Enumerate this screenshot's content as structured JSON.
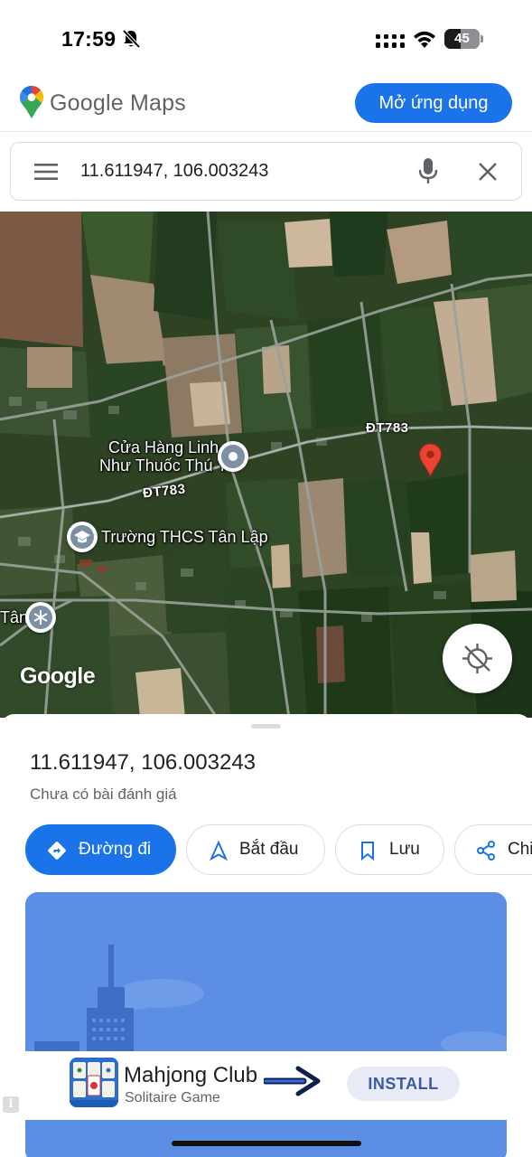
{
  "status_bar": {
    "time": "17:59",
    "battery_percent": "45",
    "battery_level": 0.45
  },
  "header": {
    "brand": "Google Maps",
    "open_app_label": "Mở ứng dụng",
    "accent_color": "#1a73e8"
  },
  "search": {
    "query": "11.611947, 106.003243",
    "icons": [
      "menu-icon",
      "mic-icon",
      "close-icon"
    ]
  },
  "map": {
    "road_labels": [
      "ĐT783",
      "ĐT783"
    ],
    "pois": [
      {
        "name_line1": "Cửa Hàng Linh",
        "name_line2": "Như Thuốc Thú Y",
        "icon": "pin-icon"
      },
      {
        "name": "Trường THCS Tân Lập",
        "icon": "school-icon"
      },
      {
        "name": "Tân",
        "icon": "snowflake-icon"
      }
    ],
    "watermark": "Google",
    "pin_color": "#ea4335"
  },
  "place": {
    "title": "11.611947, 106.003243",
    "review_status": "Chưa có bài đánh giá"
  },
  "actions": [
    {
      "label": "Đường đi",
      "icon": "directions-icon"
    },
    {
      "label": "Bắt đầu",
      "icon": "navigation-icon"
    },
    {
      "label": "Lưu",
      "icon": "bookmark-icon"
    },
    {
      "label": "Chi",
      "icon": "share-icon"
    }
  ],
  "ad": {
    "title": "Mahjong Club",
    "subtitle": "Solitaire Game",
    "install_label": "INSTALL",
    "info_glyph": "i"
  }
}
